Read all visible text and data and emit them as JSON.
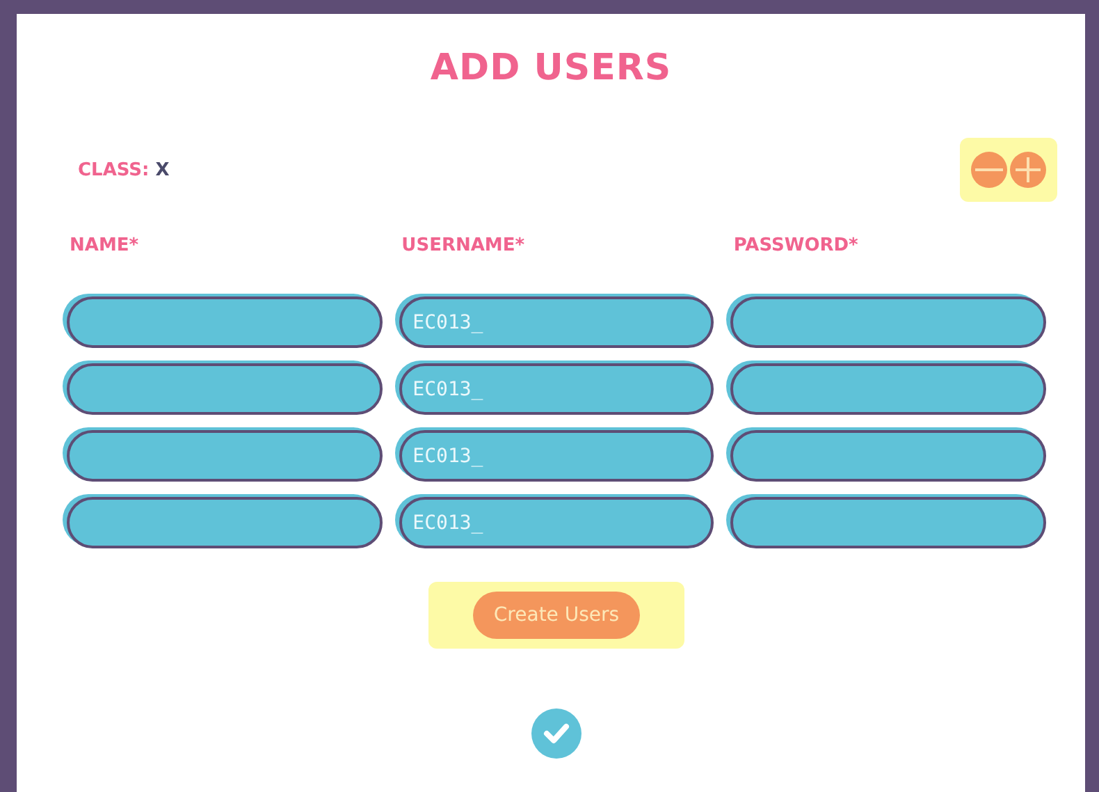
{
  "title": "ADD USERS",
  "class": {
    "label": "CLASS:",
    "value": "X"
  },
  "columns": [
    "NAME*",
    "USERNAME*",
    "PASSWORD*"
  ],
  "rows": [
    {
      "username": "EC013_"
    },
    {
      "username": "EC013_"
    },
    {
      "username": "EC013_"
    },
    {
      "username": "EC013_"
    }
  ],
  "create_button": "Create Users"
}
